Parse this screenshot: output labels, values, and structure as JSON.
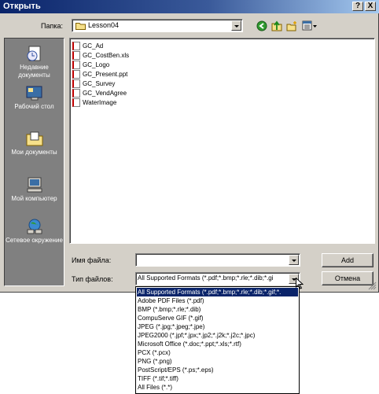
{
  "window": {
    "title": "Открыть",
    "help_label": "?",
    "close_label": "X"
  },
  "toolbar": {
    "folder_label": "Папка:",
    "folder_value": "Lesson04"
  },
  "places": [
    {
      "label": "Недавние документы"
    },
    {
      "label": "Рабочий стол"
    },
    {
      "label": "Мои документы"
    },
    {
      "label": "Мой компьютер"
    },
    {
      "label": "Сетевое окружение"
    }
  ],
  "files": [
    {
      "name": "GC_Ad"
    },
    {
      "name": "GC_CostBen.xls"
    },
    {
      "name": "GC_Logo"
    },
    {
      "name": "GC_Present.ppt"
    },
    {
      "name": "GC_Survey"
    },
    {
      "name": "GC_VendAgree"
    },
    {
      "name": "WaterImage"
    }
  ],
  "form": {
    "filename_label": "Имя файла:",
    "filename_value": "",
    "filetype_label": "Тип файлов:",
    "filetype_value": "All Supported Formats (*.pdf;*.bmp;*.rle;*.dib;*.gi",
    "open_button": "Add",
    "cancel_button": "Отмена"
  },
  "filetype_options": [
    {
      "label": "All Supported Formats (*.pdf;*.bmp;*.rle;*.dib;*.gif;*.",
      "selected": true
    },
    {
      "label": "Adobe PDF Files (*.pdf)",
      "selected": false
    },
    {
      "label": "BMP (*.bmp;*.rle;*.dib)",
      "selected": false
    },
    {
      "label": "CompuServe GIF (*.gif)",
      "selected": false
    },
    {
      "label": "JPEG (*.jpg;*.jpeg;*.jpe)",
      "selected": false
    },
    {
      "label": "JPEG2000 (*.jpf;*.jpx;*.jp2;*.j2k;*.j2c;*.jpc)",
      "selected": false
    },
    {
      "label": "Microsoft Office (*.doc;*.ppt;*.xls;*.rtf)",
      "selected": false
    },
    {
      "label": "PCX (*.pcx)",
      "selected": false
    },
    {
      "label": "PNG (*.png)",
      "selected": false
    },
    {
      "label": "PostScript/EPS (*.ps;*.eps)",
      "selected": false
    },
    {
      "label": "TIFF (*.tif;*.tiff)",
      "selected": false
    },
    {
      "label": "All Files (*.*)",
      "selected": false
    }
  ],
  "colors": {
    "titlebar_start": "#0a246a",
    "titlebar_end": "#a6caf0",
    "selection": "#0a246a",
    "dialog_face": "#d4d0c8"
  }
}
